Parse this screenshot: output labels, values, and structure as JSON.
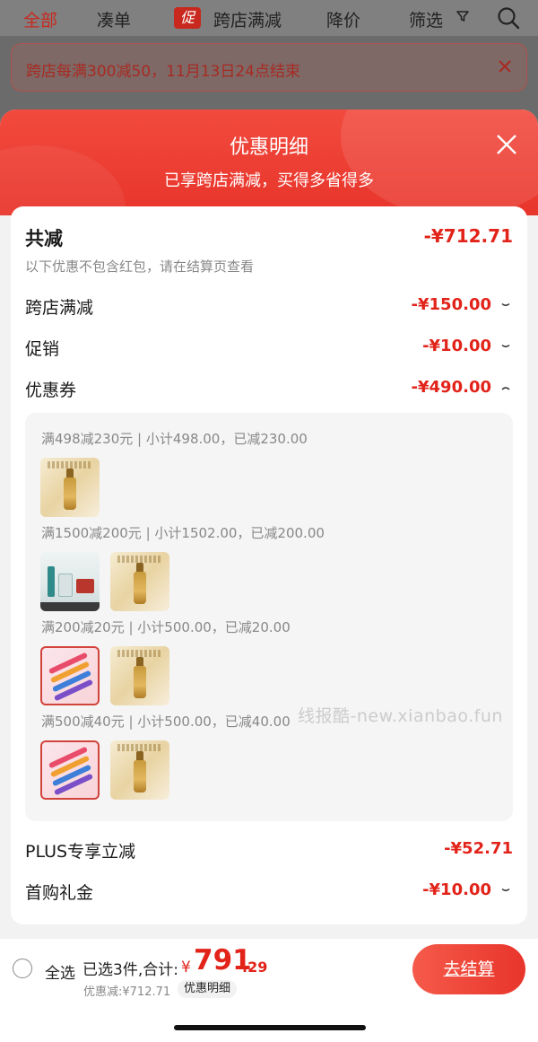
{
  "top_tabs": [
    "全部",
    "凑单",
    "跨店满减",
    "降价",
    "筛选"
  ],
  "promo_badge": "促",
  "notice_text": "跨店每满300减50，11月13日24点结束",
  "sheet": {
    "title": "优惠明细",
    "subtitle": "已享跨店满减，买得多省得多"
  },
  "summary": {
    "total_label": "共减",
    "total_amount": "-¥712.71",
    "hint": "以下优惠不包含红包，请在结算页查看"
  },
  "discounts": [
    {
      "label": "跨店满减",
      "amount": "-¥150.00"
    },
    {
      "label": "促销",
      "amount": "-¥10.00"
    },
    {
      "label": "优惠券",
      "amount": "-¥490.00"
    }
  ],
  "coupon_groups": [
    {
      "text": "满498减230元 | 小计498.00，已减230.00",
      "items": [
        "serum"
      ]
    },
    {
      "text": "满1500减200元 | 小计1502.00，已减200.00",
      "items": [
        "set",
        "serum"
      ]
    },
    {
      "text": "满200减20元 | 小计500.00，已减20.00",
      "items": [
        "pens",
        "serum"
      ]
    },
    {
      "text": "满500减40元 | 小计500.00，已减40.00",
      "items": [
        "pens",
        "serum"
      ]
    }
  ],
  "extra_discounts": [
    {
      "label": "PLUS专享立减",
      "amount": "-¥52.71"
    },
    {
      "label": "首购礼金",
      "amount": "-¥10.00"
    }
  ],
  "bottom": {
    "select_all": "全选",
    "selected_info": "已选3件,合计:",
    "currency": "¥",
    "price_int": "791",
    "price_dec": ".29",
    "saved": "优惠减:¥712.71",
    "detail_button": "优惠明细",
    "checkout": "去结算"
  },
  "watermark": "线报酷-new.xianbao.fun",
  "colors": {
    "accent": "#e2231a",
    "header_red": "#f24a3e"
  }
}
